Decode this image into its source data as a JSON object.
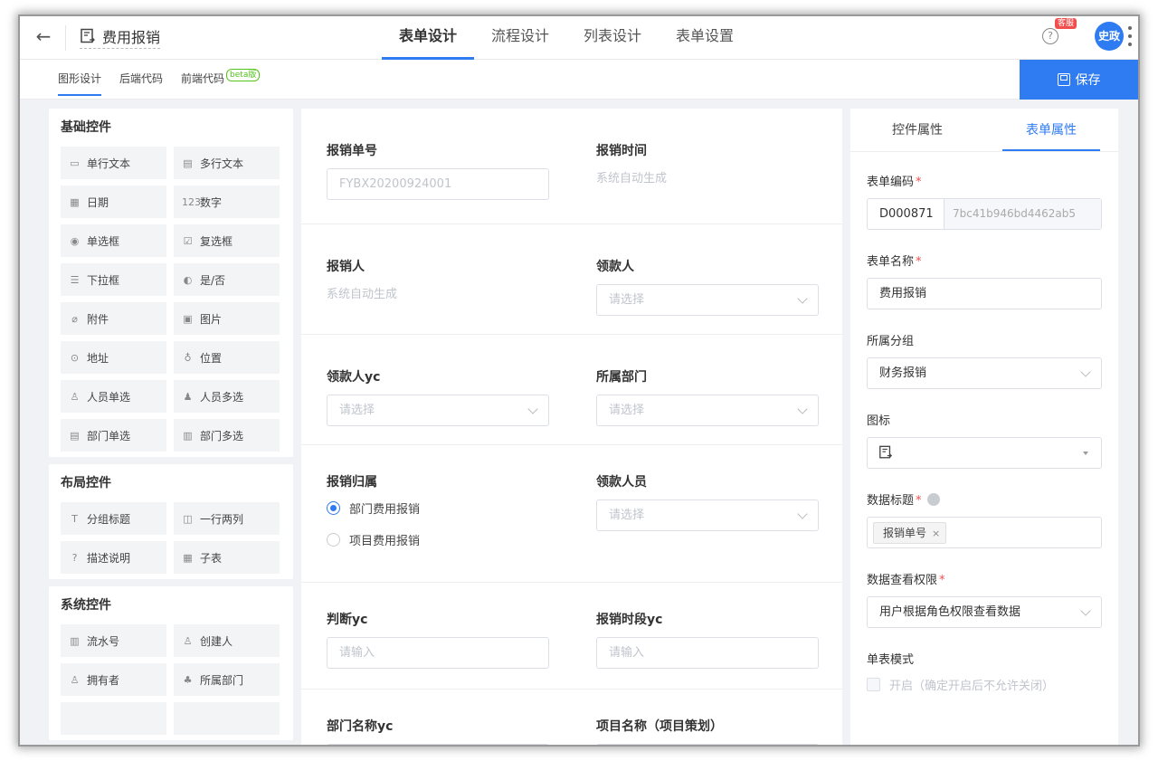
{
  "header": {
    "back_icon": "arrow-left-icon",
    "title": "费用报销",
    "tabs": [
      {
        "label": "表单设计",
        "active": true
      },
      {
        "label": "流程设计",
        "active": false
      },
      {
        "label": "列表设计",
        "active": false
      },
      {
        "label": "表单设置",
        "active": false
      }
    ],
    "badge": "客服",
    "help_glyph": "?",
    "avatar": "史政"
  },
  "subbar": {
    "tabs": [
      "图形设计",
      "后端代码",
      "前端代码"
    ],
    "beta": "beta版",
    "save_label": "保存"
  },
  "palette": {
    "sections": [
      {
        "title": "基础控件",
        "items": [
          {
            "label": "单行文本",
            "glyph": "▭"
          },
          {
            "label": "多行文本",
            "glyph": "▤"
          },
          {
            "label": "日期",
            "glyph": "▦"
          },
          {
            "label": "数字",
            "glyph": "123"
          },
          {
            "label": "单选框",
            "glyph": "◉"
          },
          {
            "label": "复选框",
            "glyph": "☑"
          },
          {
            "label": "下拉框",
            "glyph": "☰"
          },
          {
            "label": "是/否",
            "glyph": "◐"
          },
          {
            "label": "附件",
            "glyph": "⌀"
          },
          {
            "label": "图片",
            "glyph": "▣"
          },
          {
            "label": "地址",
            "glyph": "⊙"
          },
          {
            "label": "位置",
            "glyph": "♁"
          },
          {
            "label": "人员单选",
            "glyph": "♙"
          },
          {
            "label": "人员多选",
            "glyph": "♟"
          },
          {
            "label": "部门单选",
            "glyph": "▤"
          },
          {
            "label": "部门多选",
            "glyph": "▥"
          }
        ]
      },
      {
        "title": "布局控件",
        "items": [
          {
            "label": "分组标题",
            "glyph": "T"
          },
          {
            "label": "一行两列",
            "glyph": "◫"
          },
          {
            "label": "描述说明",
            "glyph": "?"
          },
          {
            "label": "子表",
            "glyph": "▦"
          }
        ]
      },
      {
        "title": "系统控件",
        "items": [
          {
            "label": "流水号",
            "glyph": "▥"
          },
          {
            "label": "创建人",
            "glyph": "♙"
          },
          {
            "label": "拥有者",
            "glyph": "♙"
          },
          {
            "label": "所属部门",
            "glyph": "♣"
          },
          {
            "label": "",
            "glyph": ""
          },
          {
            "label": "",
            "glyph": ""
          }
        ]
      }
    ]
  },
  "canvas": {
    "rows": [
      {
        "left": {
          "label": "报销单号",
          "type": "input-value",
          "text": "FYBX20200924001"
        },
        "right": {
          "label": "报销时间",
          "type": "hint",
          "text": "系统自动生成"
        }
      },
      {
        "left": {
          "label": "报销人",
          "type": "hint",
          "text": "系统自动生成"
        },
        "right": {
          "label": "领款人",
          "type": "select",
          "text": "请选择"
        }
      },
      {
        "left": {
          "label": "领款人yc",
          "type": "select",
          "text": "请选择"
        },
        "right": {
          "label": "所属部门",
          "type": "select",
          "text": "请选择"
        }
      },
      {
        "left": {
          "label": "报销归属",
          "type": "radio",
          "options": [
            "部门费用报销",
            "项目费用报销"
          ],
          "selected": 0
        },
        "right": {
          "label": "领款人员",
          "type": "select",
          "text": "请选择"
        }
      },
      {
        "left": {
          "label": "判断yc",
          "type": "input",
          "text": "请输入"
        },
        "right": {
          "label": "报销时段yc",
          "type": "input",
          "text": "请输入"
        }
      },
      {
        "left": {
          "label": "部门名称yc",
          "type": "input",
          "text": ""
        },
        "right": {
          "label": "项目名称（项目策划）",
          "type": "input",
          "text": ""
        }
      }
    ]
  },
  "props": {
    "tabs": [
      "控件属性",
      "表单属性"
    ],
    "active_tab": 1,
    "form_code_label": "表单编码",
    "form_code": "D000871",
    "form_hash": "7bc41b946bd4462ab5",
    "form_name_label": "表单名称",
    "form_name": "费用报销",
    "group_label": "所属分组",
    "group_value": "财务报销",
    "icon_label": "图标",
    "data_title_label": "数据标题",
    "data_title_tag": "报销单号",
    "tag_close": "×",
    "permission_label": "数据查看权限",
    "permission_value": "用户根据角色权限查看数据",
    "single_mode_label": "单表模式",
    "single_mode_text": "开启（确定开启后不允许关闭）",
    "required_mark": "*"
  },
  "colors": {
    "accent": "#2f7bf1",
    "badge": "#f24e4e",
    "beta": "#52c41a"
  }
}
